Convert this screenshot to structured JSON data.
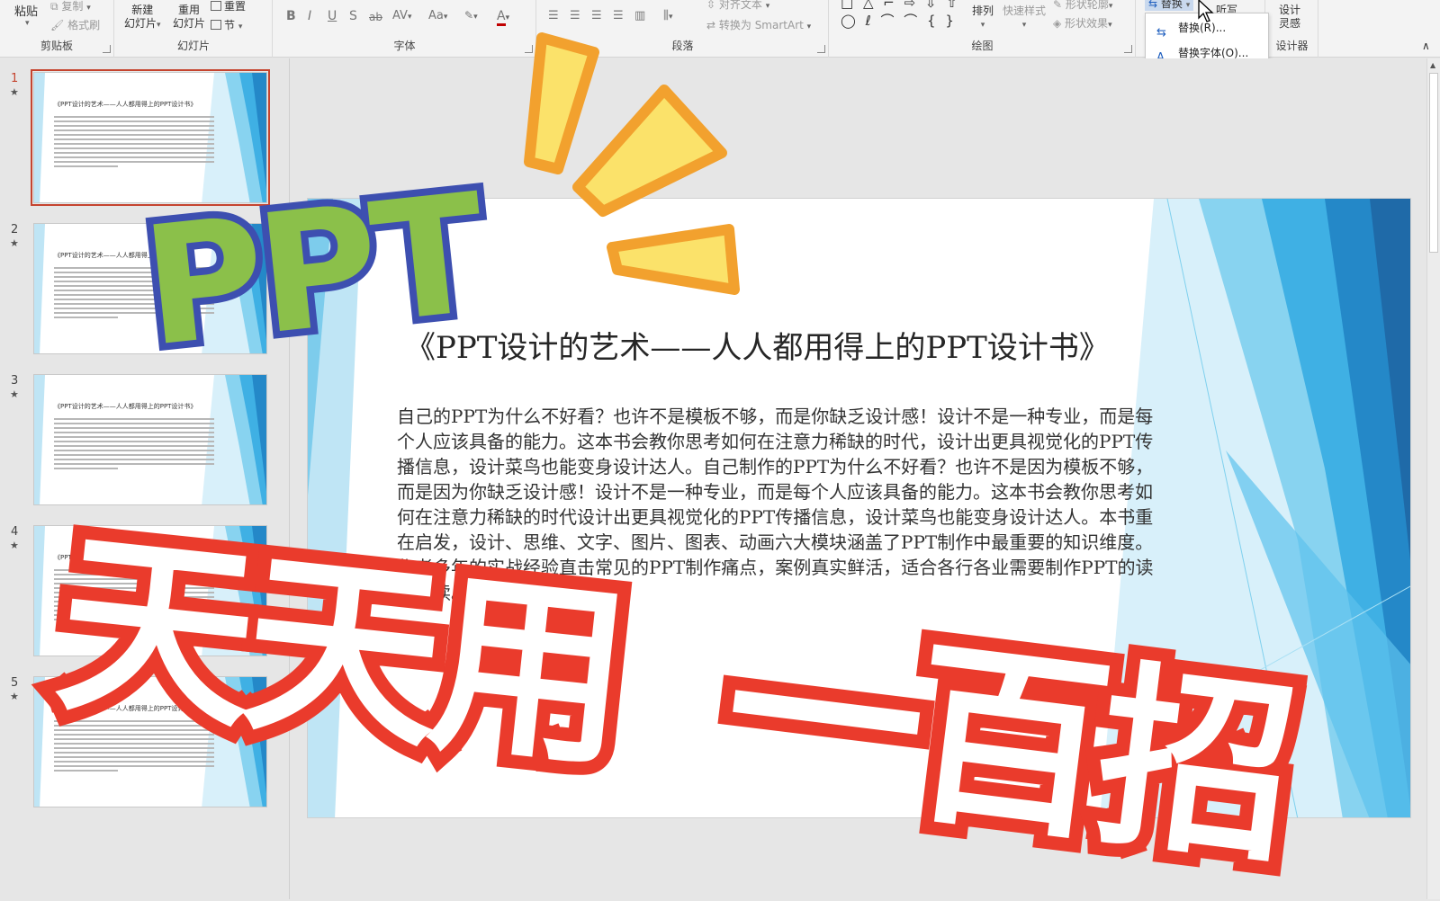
{
  "ribbon": {
    "clipboard": {
      "paste": "粘贴",
      "copy": "复制",
      "format_painter": "格式刷",
      "group_label": "剪贴板"
    },
    "slides": {
      "new_slide": "新建",
      "new_slide_sub": "幻灯片",
      "reuse": "重用",
      "reuse_sub": "幻灯片",
      "reset": "重置",
      "section": "节",
      "group_label": "幻灯片"
    },
    "font": {
      "bold": "B",
      "italic": "I",
      "underline": "U",
      "shadow": "S",
      "strike": "ab",
      "spacing": "AV",
      "case": "Aa",
      "highlight": "ab",
      "color": "A",
      "group_label": "字体"
    },
    "paragraph": {
      "align_text": "对齐文本",
      "smartart": "转换为 SmartArt",
      "group_label": "段落"
    },
    "drawing": {
      "shapes_row1": "□ △ ⌐ ⇨ ⇩ ⇧",
      "shapes_row2": "◯ ℓ ⌒ ⌒ { }",
      "arrange": "排列",
      "quick_styles": "快速样式",
      "shape_outline": "形状轮廓",
      "shape_effects": "形状效果",
      "group_label": "绘图"
    },
    "editing": {
      "replace": "替换",
      "dictate": "听写"
    },
    "designer": {
      "design_ideas_1": "设计",
      "design_ideas_2": "灵感",
      "group_label": "设计器"
    }
  },
  "replace_menu": {
    "items": [
      "替换(R)...",
      "替换字体(O)..."
    ]
  },
  "thumbnails": [
    {
      "num": "1",
      "title": "《PPT设计的艺术——人人都用得上的PPT设计书》"
    },
    {
      "num": "2",
      "title": "《PPT设计的艺术——人人都用得上的PPT设计书》"
    },
    {
      "num": "3",
      "title": "《PPT设计的艺术——人人都用得上的PPT设计书》"
    },
    {
      "num": "4",
      "title": "《PPT设计的艺术——人人都用得上的PPT设计书》"
    },
    {
      "num": "5",
      "title": "《PPT设计的艺术——人人都用得上的PPT设计书》"
    }
  ],
  "slide": {
    "title": "《PPT设计的艺术——人人都用得上的PPT设计书》",
    "body": "自己的PPT为什么不好看？也许不是模板不够，而是你缺乏设计感！设计不是一种专业，而是每个人应该具备的能力。这本书会教你思考如何在注意力稀缺的时代，设计出更具视觉化的PPT传播信息，设计菜鸟也能变身设计达人。自己制作的PPT为什么不好看？也许不是因为模板不够，而是因为你缺乏设计感！设计不是一种专业，而是每个人应该具备的能力。这本书会教你思考如何在注意力稀缺的时代设计出更具视觉化的PPT传播信息，设计菜鸟也能变身设计达人。本书重在启发，设计、思维、文字、图片、图表、动画六大模块涵盖了PPT制作中最重要的知识维度。作者多年的实战经验直击常见的PPT制作痛点，案例真实鲜活，适合各行各业需要制作PPT的读者阅读。——如果……"
  },
  "overlay": {
    "ppt": "PPT",
    "daily": "天天用",
    "hundred": "一百招"
  },
  "colors": {
    "accent_blue": "#2b8fd1",
    "ppt_fill": "#8bc04a",
    "ppt_outline": "#3d4fb0",
    "red_outline": "#ea3b2c",
    "burst_yellow": "#fbe26a",
    "burst_orange": "#f2a12e",
    "selection_red": "#c5442f"
  }
}
